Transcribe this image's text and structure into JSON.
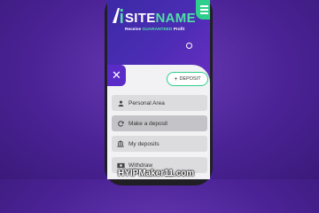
{
  "brand": {
    "name_prefix": "SITE",
    "name_suffix": "NAME",
    "tagline_prefix": "Receive",
    "tagline_accent": "GUARANTEED",
    "tagline_suffix": "Profit",
    "accent_color": "#4ee0a5"
  },
  "header": {
    "menu_icon": "hamburger-icon",
    "close_icon": "close-icon",
    "close_symbol": "✕"
  },
  "deposit_button": {
    "label": "DEPOSIT",
    "icon": "plus-icon",
    "icon_symbol": "+"
  },
  "menu": {
    "items": [
      {
        "label": "Personal Area",
        "icon": "user-icon",
        "active": false
      },
      {
        "label": "Make a deposit",
        "icon": "refresh-icon",
        "active": true
      },
      {
        "label": "My deposits",
        "icon": "bank-icon",
        "active": false
      },
      {
        "label": "Withdraw",
        "icon": "cash-icon",
        "active": false
      }
    ]
  },
  "watermark": {
    "text": "HYIPMaker11.com"
  },
  "colors": {
    "primary": "#5b2bc7",
    "green": "#2ecf8c",
    "background": "#4c2397"
  }
}
